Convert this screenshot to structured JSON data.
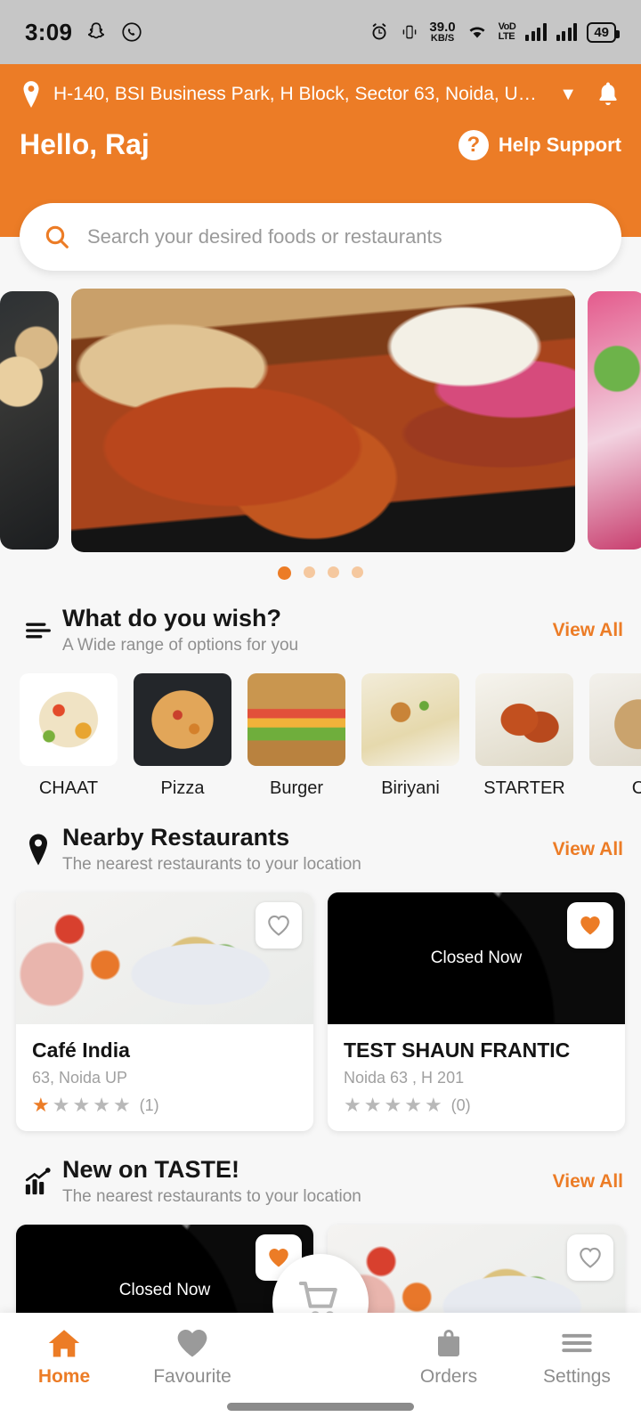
{
  "status_bar": {
    "time": "3:09",
    "network_speed_value": "39.0",
    "network_speed_unit": "KB/S",
    "volte_top": "VoD",
    "volte_bottom": "LTE",
    "battery": "49",
    "icons": [
      "snapchat-icon",
      "whatsapp-icon",
      "alarm-icon",
      "vibrate-icon",
      "wifi-icon",
      "signal-icon",
      "battery-icon"
    ]
  },
  "header": {
    "address": "H-140, BSI Business Park, H Block, Sector 63, Noida, Uttar ...",
    "greeting": "Hello, Raj",
    "help_label": "Help Support",
    "help_icon": "question-mark-icon",
    "location_icon": "location-pin-icon",
    "dropdown_icon": "chevron-down-icon",
    "notification_icon": "bell-icon",
    "accent_color": "#EC7C26"
  },
  "search": {
    "placeholder": "Search your desired foods or restaurants",
    "value": "",
    "icon": "search-icon"
  },
  "carousel": {
    "total_dots": 4,
    "active_index": 0
  },
  "wish_section": {
    "icon": "menu-lines-icon",
    "title": "What do you wish?",
    "subtitle": "A Wide range of options for you",
    "view_all": "View All",
    "categories": [
      {
        "label": "CHAAT",
        "image": "chaat-image"
      },
      {
        "label": "Pizza",
        "image": "pizza-image"
      },
      {
        "label": "Burger",
        "image": "burger-image"
      },
      {
        "label": "Biriyani",
        "image": "biriyani-image"
      },
      {
        "label": "STARTER",
        "image": "starter-image"
      },
      {
        "label": "C",
        "image": "cake-image"
      }
    ]
  },
  "nearby_section": {
    "icon": "location-pin-icon",
    "title": "Nearby Restaurants",
    "subtitle": "The nearest restaurants to your location",
    "view_all": "View All",
    "restaurants": [
      {
        "name": "Café India",
        "address": "63, Noida UP",
        "rating": 1,
        "review_count": "(1)",
        "favourite": false,
        "closed": false,
        "closed_label": ""
      },
      {
        "name": "TEST SHAUN FRANTIC",
        "address": "Noida 63 , H 201",
        "rating": 0,
        "review_count": "(0)",
        "favourite": true,
        "closed": true,
        "closed_label": "Closed Now"
      }
    ]
  },
  "new_section": {
    "icon": "trending-chart-icon",
    "title": "New on TASTE!",
    "subtitle": "The nearest restaurants to your location",
    "view_all": "View All",
    "restaurants": [
      {
        "name": "",
        "favourite": true,
        "closed": true,
        "closed_label": "Closed Now"
      },
      {
        "name": "",
        "favourite": false,
        "closed": false,
        "closed_label": ""
      }
    ]
  },
  "bottom_nav": {
    "items": [
      {
        "label": "Home",
        "icon": "home-icon",
        "active": true
      },
      {
        "label": "Favourite",
        "icon": "heart-icon",
        "active": false
      },
      {
        "label": "Orders",
        "icon": "bag-icon",
        "active": false
      },
      {
        "label": "Settings",
        "icon": "menu-icon",
        "active": false
      }
    ],
    "fab_icon": "shopping-cart-icon"
  }
}
